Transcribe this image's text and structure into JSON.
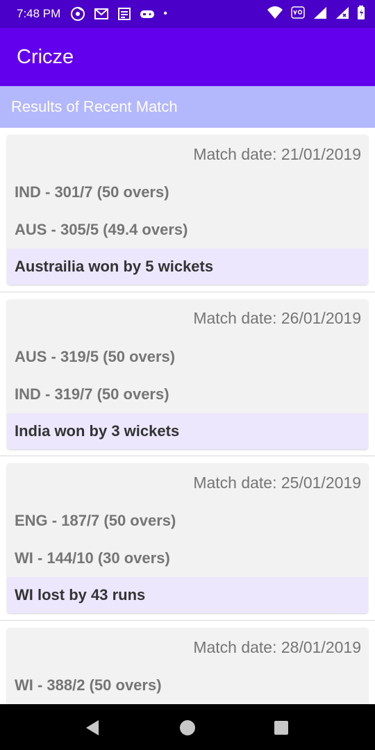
{
  "status_bar": {
    "time": "7:48 PM",
    "left_icons": [
      "music-disc-icon",
      "gmail-icon",
      "news-icon",
      "gamepad-icon"
    ],
    "dot": "•",
    "right_icons": [
      "wifi-icon",
      "volte-icon",
      "signal-icon",
      "signal-x-icon",
      "battery-icon"
    ]
  },
  "app_bar": {
    "title": "Cricze"
  },
  "subheader": {
    "text": "Results of Recent Match"
  },
  "matches": [
    {
      "date": "Match date: 21/01/2019",
      "team1": "IND - 301/7 (50 overs)",
      "team2": "AUS - 305/5 (49.4 overs)",
      "result": "Austrailia won by 5 wickets"
    },
    {
      "date": "Match date: 26/01/2019",
      "team1": "AUS - 319/5 (50 overs)",
      "team2": "IND - 319/7 (50 overs)",
      "result": "India won by 3 wickets"
    },
    {
      "date": "Match date: 25/01/2019",
      "team1": "ENG - 187/7 (50 overs)",
      "team2": "WI - 144/10 (30 overs)",
      "result": "WI lost by 43 runs"
    },
    {
      "date": "Match date: 28/01/2019",
      "team1": "WI - 388/2 (50 overs)",
      "team2": "",
      "result": ""
    }
  ],
  "nav_bar": {
    "icons": [
      "back-icon",
      "home-icon",
      "recents-icon"
    ]
  },
  "colors": {
    "status_bar": "#4a00c8",
    "app_bar": "#6200ee",
    "subheader": "#b3b7fc",
    "card": "#f2f2f2",
    "result_bg": "#ece7fd"
  }
}
